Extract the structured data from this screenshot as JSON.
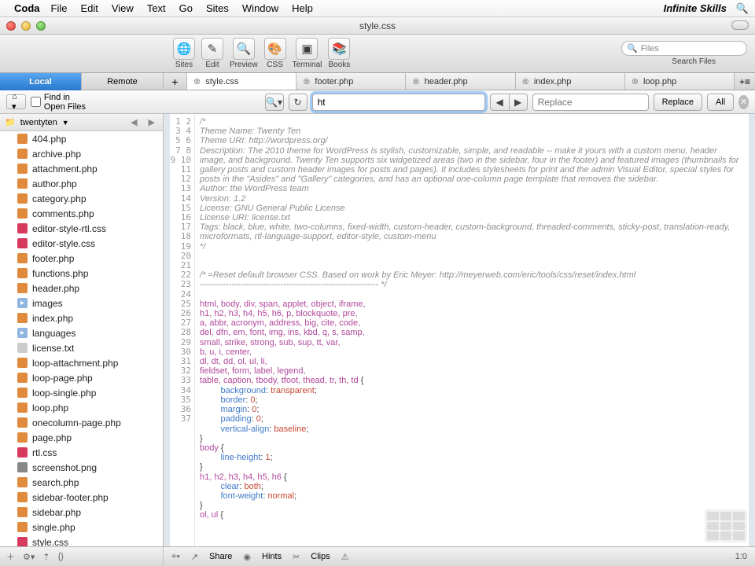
{
  "menu": {
    "app": "Coda",
    "items": [
      "File",
      "Edit",
      "View",
      "Text",
      "Go",
      "Sites",
      "Window",
      "Help"
    ],
    "brand": "Infinite Skills"
  },
  "window": {
    "title": "style.css"
  },
  "toolbar": {
    "items": [
      {
        "label": "Sites",
        "icon": "🌐"
      },
      {
        "label": "Edit",
        "icon": "✎"
      },
      {
        "label": "Preview",
        "icon": "🔍"
      },
      {
        "label": "CSS",
        "icon": "🎨"
      },
      {
        "label": "Terminal",
        "icon": "▣"
      },
      {
        "label": "Books",
        "icon": "📚"
      }
    ],
    "search_placeholder": "Files",
    "search_label": "Search Files"
  },
  "location_tabs": {
    "active": "Local",
    "other": "Remote"
  },
  "file_tabs": [
    {
      "name": "style.css",
      "active": true
    },
    {
      "name": "footer.php"
    },
    {
      "name": "header.php"
    },
    {
      "name": "index.php"
    },
    {
      "name": "loop.php"
    }
  ],
  "findbar": {
    "find_in_open": "Find in Open Files",
    "find_value": "ht",
    "replace_placeholder": "Replace",
    "replace_btn": "Replace",
    "all_btn": "All"
  },
  "sidebar": {
    "header": "twentyten",
    "files": [
      {
        "n": "404.php",
        "t": "php"
      },
      {
        "n": "archive.php",
        "t": "php"
      },
      {
        "n": "attachment.php",
        "t": "php"
      },
      {
        "n": "author.php",
        "t": "php"
      },
      {
        "n": "category.php",
        "t": "php"
      },
      {
        "n": "comments.php",
        "t": "php"
      },
      {
        "n": "editor-style-rtl.css",
        "t": "css"
      },
      {
        "n": "editor-style.css",
        "t": "css"
      },
      {
        "n": "footer.php",
        "t": "php"
      },
      {
        "n": "functions.php",
        "t": "php"
      },
      {
        "n": "header.php",
        "t": "php"
      },
      {
        "n": "images",
        "t": "folder"
      },
      {
        "n": "index.php",
        "t": "php"
      },
      {
        "n": "languages",
        "t": "folder"
      },
      {
        "n": "license.txt",
        "t": "txt"
      },
      {
        "n": "loop-attachment.php",
        "t": "php"
      },
      {
        "n": "loop-page.php",
        "t": "php"
      },
      {
        "n": "loop-single.php",
        "t": "php"
      },
      {
        "n": "loop.php",
        "t": "php"
      },
      {
        "n": "onecolumn-page.php",
        "t": "php"
      },
      {
        "n": "page.php",
        "t": "php"
      },
      {
        "n": "rtl.css",
        "t": "css"
      },
      {
        "n": "screenshot.png",
        "t": "img"
      },
      {
        "n": "search.php",
        "t": "php"
      },
      {
        "n": "sidebar-footer.php",
        "t": "php"
      },
      {
        "n": "sidebar.php",
        "t": "php"
      },
      {
        "n": "single.php",
        "t": "php"
      },
      {
        "n": "style.css",
        "t": "css"
      }
    ]
  },
  "status": {
    "share": "Share",
    "hints": "Hints",
    "clips": "Clips",
    "col": "1:0"
  },
  "code": {
    "lines": [
      "/*",
      "Theme Name: Twenty Ten",
      "Theme URI: http://wordpress.org/",
      "Description: The 2010 theme for WordPress is stylish, customizable, simple, and readable -- make it yours with a custom menu, header image, and background. Twenty Ten supports six widgetized areas (two in the sidebar, four in the footer) and featured images (thumbnails for gallery posts and custom header images for posts and pages). It includes stylesheets for print and the admin Visual Editor, special styles for posts in the \"Asides\" and \"Gallery\" categories, and has an optional one-column page template that removes the sidebar.",
      "Author: the WordPress team",
      "Version: 1.2",
      "License: GNU General Public License",
      "License URI: license.txt",
      "Tags: black, blue, white, two-columns, fixed-width, custom-header, custom-background, threaded-comments, sticky-post, translation-ready, microformats, rtl-language-support, editor-style, custom-menu",
      "*/",
      "",
      "",
      "/* =Reset default browser CSS. Based on work by Eric Meyer: http://meyerweb.com/eric/tools/css/reset/index.html",
      "-------------------------------------------------------------- */",
      "",
      "html, body, div, span, applet, object, iframe,",
      "h1, h2, h3, h4, h5, h6, p, blockquote, pre,",
      "a, abbr, acronym, address, big, cite, code,",
      "del, dfn, em, font, img, ins, kbd, q, s, samp,",
      "small, strike, strong, sub, sup, tt, var,",
      "b, u, i, center,",
      "dl, dt, dd, ol, ul, li,",
      "fieldset, form, label, legend,",
      "table, caption, tbody, tfoot, thead, tr, th, td {",
      "    background: transparent;",
      "    border: 0;",
      "    margin: 0;",
      "    padding: 0;",
      "    vertical-align: baseline;",
      "}",
      "body {",
      "    line-height: 1;",
      "}",
      "h1, h2, h3, h4, h5, h6 {",
      "    clear: both;",
      "    font-weight: normal;",
      "}",
      "ol, ul {"
    ],
    "linenums": [
      1,
      2,
      3,
      4,
      5,
      6,
      7,
      8,
      9,
      10,
      11,
      12,
      13,
      14,
      15,
      16,
      17,
      18,
      19,
      20,
      21,
      22,
      23,
      24,
      25,
      26,
      27,
      28,
      29,
      30,
      31,
      32,
      33,
      34,
      35,
      36,
      37
    ]
  }
}
